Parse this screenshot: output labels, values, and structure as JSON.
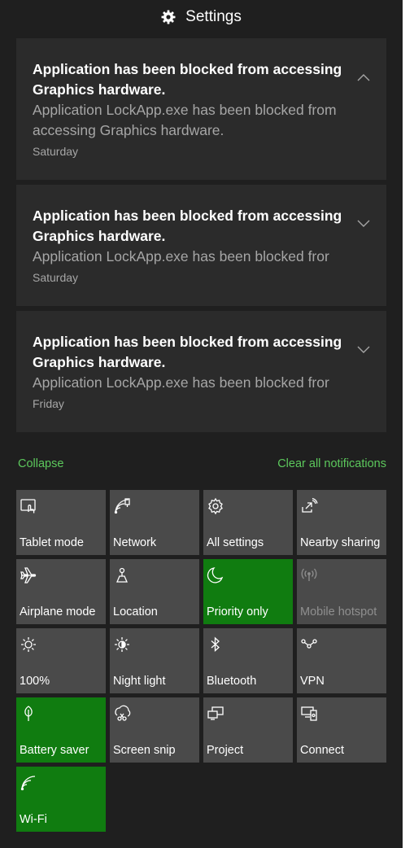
{
  "header": {
    "title": "Settings",
    "icon": "gear-icon"
  },
  "notifications": [
    {
      "title": "Application has been blocked from accessing Graphics hardware.",
      "body": "Application LockApp.exe has been blocked from accessing Graphics hardware.",
      "time": "Saturday",
      "expanded": true
    },
    {
      "title": "Application has been blocked from accessing Graphics hardware.",
      "body": "Application LockApp.exe has been blocked fror",
      "time": "Saturday",
      "expanded": false
    },
    {
      "title": "Application has been blocked from accessing Graphics hardware.",
      "body": "Application LockApp.exe has been blocked fror",
      "time": "Friday",
      "expanded": false
    }
  ],
  "actions": {
    "collapse": "Collapse",
    "clear_all": "Clear all notifications"
  },
  "quick_actions": [
    {
      "label": "Tablet mode",
      "icon": "tablet-mode-icon",
      "active": false,
      "disabled": false
    },
    {
      "label": "Network",
      "icon": "network-icon",
      "active": false,
      "disabled": false
    },
    {
      "label": "All settings",
      "icon": "gear-icon",
      "active": false,
      "disabled": false
    },
    {
      "label": "Nearby sharing",
      "icon": "nearby-sharing-icon",
      "active": false,
      "disabled": false
    },
    {
      "label": "Airplane mode",
      "icon": "airplane-icon",
      "active": false,
      "disabled": false
    },
    {
      "label": "Location",
      "icon": "location-icon",
      "active": false,
      "disabled": false
    },
    {
      "label": "Priority only",
      "icon": "moon-icon",
      "active": true,
      "disabled": false
    },
    {
      "label": "Mobile hotspot",
      "icon": "hotspot-icon",
      "active": false,
      "disabled": true
    },
    {
      "label": "100%",
      "icon": "brightness-icon",
      "active": false,
      "disabled": false
    },
    {
      "label": "Night light",
      "icon": "night-light-icon",
      "active": false,
      "disabled": false
    },
    {
      "label": "Bluetooth",
      "icon": "bluetooth-icon",
      "active": false,
      "disabled": false
    },
    {
      "label": "VPN",
      "icon": "vpn-icon",
      "active": false,
      "disabled": false
    },
    {
      "label": "Battery saver",
      "icon": "battery-saver-icon",
      "active": true,
      "disabled": false
    },
    {
      "label": "Screen snip",
      "icon": "screen-snip-icon",
      "active": false,
      "disabled": false
    },
    {
      "label": "Project",
      "icon": "project-icon",
      "active": false,
      "disabled": false
    },
    {
      "label": "Connect",
      "icon": "connect-icon",
      "active": false,
      "disabled": false
    },
    {
      "label": "Wi-Fi",
      "icon": "wifi-icon",
      "active": true,
      "disabled": false
    }
  ],
  "colors": {
    "panel_bg": "#1f1f1f",
    "card_bg": "#2b2b2b",
    "tile_bg": "#4a4a4a",
    "tile_active": "#107c10",
    "link": "#5cc85c"
  }
}
